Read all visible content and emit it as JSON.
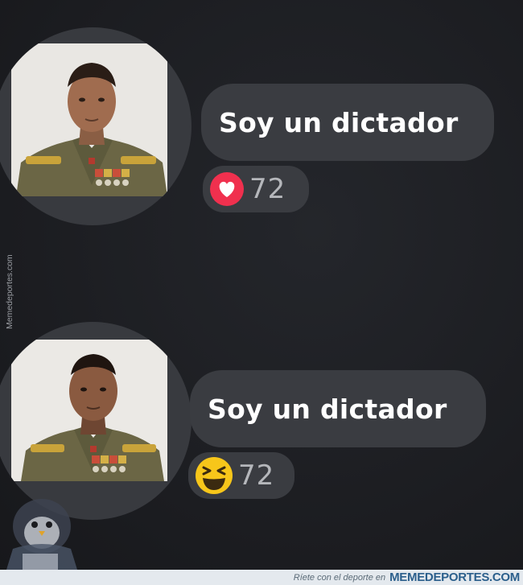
{
  "messages": [
    {
      "text": "Soy un dictador",
      "reaction_icon": "heart-icon",
      "reaction_color": "#f0304e",
      "reaction_count": "72"
    },
    {
      "text": "Soy un dictador",
      "reaction_icon": "laughing-emoji-icon",
      "reaction_color": "#f7c61a",
      "reaction_count": "72"
    }
  ],
  "watermark": {
    "side_text": "Memedeportes.com",
    "footer_tagline": "Ríete con el deporte en",
    "footer_brand": "MEMEDEPORTES.COM"
  },
  "colors": {
    "background": "#1d1e22",
    "bubble": "#3a3c41",
    "uniform": "#6b6645"
  }
}
